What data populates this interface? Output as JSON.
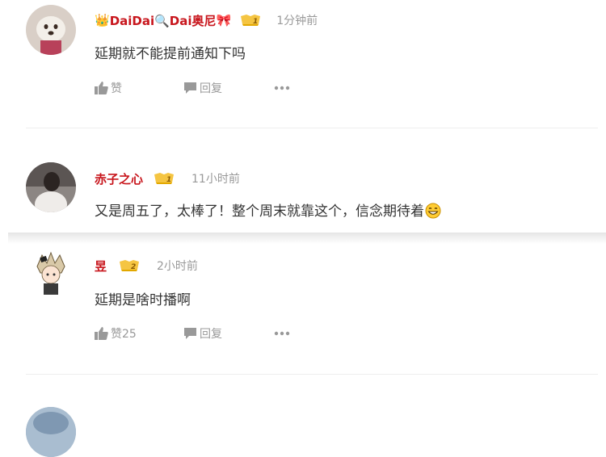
{
  "comments": [
    {
      "author_prefix": "👑",
      "author": "DaiDai🔍Dai奥尼",
      "author_suffix": "🎀",
      "level": "1",
      "time": "1分钟前",
      "content": "延期就不能提前通知下吗",
      "like_label": "赞",
      "reply_label": "回复"
    },
    {
      "author": "赤子之心",
      "level": "1",
      "time": "11小时前",
      "content": "又是周五了，太棒了！整个周末就靠这个，信念期待着"
    },
    {
      "author": "昱",
      "level": "2",
      "time": "2小时前",
      "content": "延期是啥时播啊",
      "like_label": "赞25",
      "reply_label": "回复"
    }
  ],
  "colors": {
    "author": "#c8161d",
    "meta": "#999999",
    "badge": "#f5b400"
  },
  "icons": [
    "thumbs-up-icon",
    "comment-bubble-icon",
    "more-dots-icon",
    "grin-emoji-icon",
    "level-badge-icon"
  ]
}
